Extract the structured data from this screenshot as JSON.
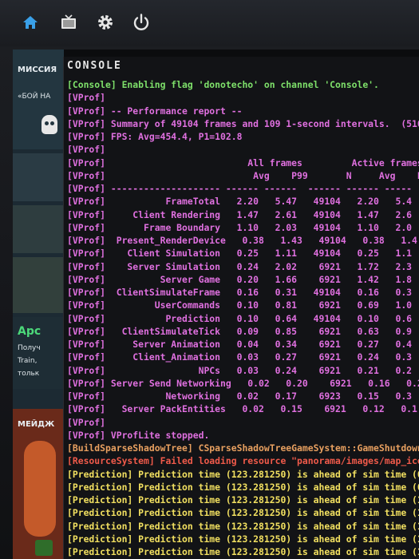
{
  "taskbar": {
    "icons": [
      "home-icon",
      "tv-icon",
      "gear-icon",
      "power-icon"
    ],
    "accent": "#3aa0e8"
  },
  "left_panel": {
    "title_1": "МИССИЯ",
    "text_1": "«БОЙ НА",
    "title_2": "Apc",
    "text_2a": "Получ",
    "text_2b": "Train,",
    "text_2c": "тольк",
    "title_3": "МЕЙДЖ"
  },
  "console": {
    "title": "CONSOLE",
    "lines": [
      {
        "type": "console",
        "text": "[Console] Enabling flag 'donotecho' on channel 'Console'."
      },
      {
        "type": "vprof",
        "text": "[VProf]"
      },
      {
        "type": "vprof",
        "text": "[VProf] -- Performance report --"
      },
      {
        "type": "vprof",
        "text": "[VProf] Summary of 49104 frames and 109 1-second intervals.  (510"
      },
      {
        "type": "vprof",
        "text": "[VProf] FPS: Avg=454.4, P1=102.8"
      },
      {
        "type": "vprof",
        "text": "[VProf]"
      },
      {
        "type": "vprof",
        "text": "[VProf]                          All frames         Active frames"
      },
      {
        "type": "vprof",
        "text": "[VProf]                           Avg    P99       N     Avg    P"
      },
      {
        "type": "vprof",
        "text": "[VProf] -------------------- ------ ------  ------ ------ -----"
      },
      {
        "type": "vprof",
        "text": "[VProf]           FrameTotal   2.20   5.47   49104   2.20   5.4"
      },
      {
        "type": "vprof",
        "text": "[VProf]     Client Rendering   1.47   2.61   49104   1.47   2.6"
      },
      {
        "type": "vprof",
        "text": "[VProf]       Frame Boundary   1.10   2.03   49104   1.10   2.0"
      },
      {
        "type": "vprof",
        "text": "[VProf]  Present_RenderDevice   0.38   1.43   49104   0.38   1.4"
      },
      {
        "type": "vprof",
        "text": "[VProf]    Client Simulation   0.25   1.11   49104   0.25   1.1"
      },
      {
        "type": "vprof",
        "text": "[VProf]    Server Simulation   0.24   2.02    6921   1.72   2.3"
      },
      {
        "type": "vprof",
        "text": "[VProf]          Server Game   0.20   1.66    6921   1.42   1.8"
      },
      {
        "type": "vprof",
        "text": "[VProf]  ClientSimulateFrame   0.16   0.31   49104   0.16   0.3"
      },
      {
        "type": "vprof",
        "text": "[VProf]         UserCommands   0.10   0.81    6921   0.69   1.0"
      },
      {
        "type": "vprof",
        "text": "[VProf]           Prediction   0.10   0.64   49104   0.10   0.6"
      },
      {
        "type": "vprof",
        "text": "[VProf]   ClientSimulateTick   0.09   0.85    6921   0.63   0.9"
      },
      {
        "type": "vprof",
        "text": "[VProf]     Server Animation   0.04   0.34    6921   0.27   0.4"
      },
      {
        "type": "vprof",
        "text": "[VProf]     Client_Animation   0.03   0.27    6921   0.24   0.3"
      },
      {
        "type": "vprof",
        "text": "[VProf]                 NPCs   0.03   0.24    6921   0.21   0.2"
      },
      {
        "type": "vprof",
        "text": "[VProf] Server Send Networking   0.02   0.20    6921   0.16   0.2"
      },
      {
        "type": "vprof",
        "text": "[VProf]           Networking   0.02   0.17    6923   0.15   0.3"
      },
      {
        "type": "vprof",
        "text": "[VProf]   Server PackEntities   0.02   0.15    6921   0.12   0.1"
      },
      {
        "type": "vprof",
        "text": "[VProf]"
      },
      {
        "type": "vprof",
        "text": "[VProf] VProfLite stopped."
      },
      {
        "type": "build",
        "text": "[BuildSparseShadowTree] CSparseShadowTreeGameSystem::GameShutdown"
      },
      {
        "type": "resource",
        "text": "[ResourceSystem] Failed loading resource \"panorama/images/map_icon"
      },
      {
        "type": "pred",
        "text": "[Prediction] Prediction time (123.281250) is ahead of sim time (0."
      },
      {
        "type": "pred",
        "text": "[Prediction] Prediction time (123.281250) is ahead of sim time (0."
      },
      {
        "type": "pred",
        "text": "[Prediction] Prediction time (123.281250) is ahead of sim time (1."
      },
      {
        "type": "pred",
        "text": "[Prediction] Prediction time (123.281250) is ahead of sim time (1."
      },
      {
        "type": "pred",
        "text": "[Prediction] Prediction time (123.281250) is ahead of sim time (1."
      },
      {
        "type": "pred",
        "text": "[Prediction] Prediction time (123.281250) is ahead of sim time (1."
      },
      {
        "type": "pred",
        "text": "[Prediction] Prediction time (123.281250) is ahead of sim time (1."
      },
      {
        "type": "pred",
        "text": "[Prediction] Prediction time (123.281250) is ahead of sim time (1."
      }
    ]
  }
}
